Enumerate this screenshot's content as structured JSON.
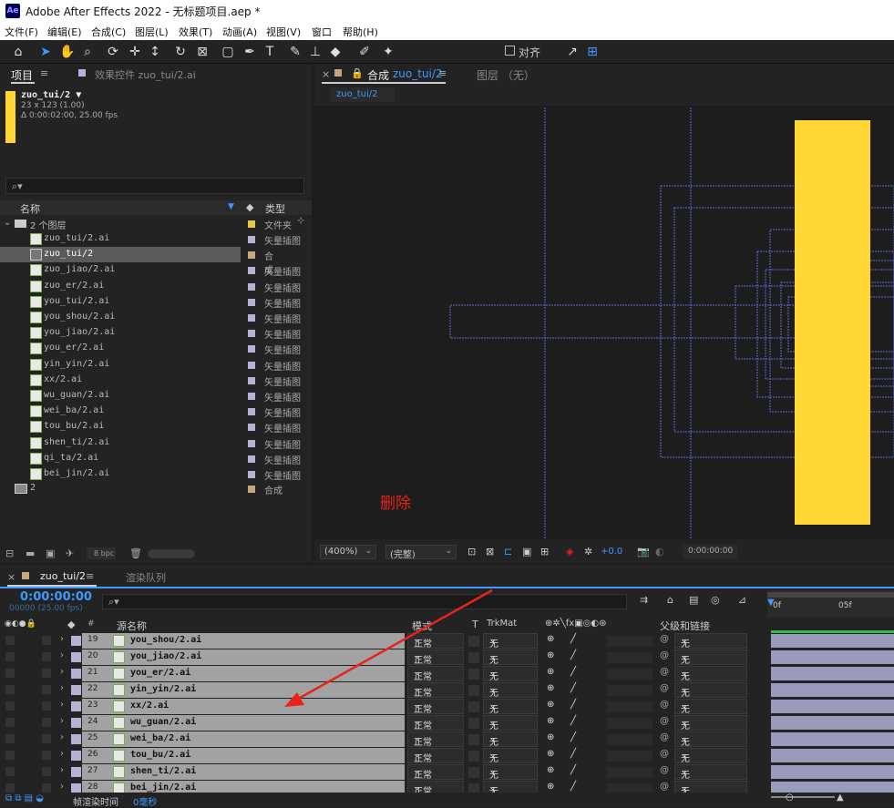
{
  "window": {
    "title": "Adobe After Effects 2022 - 无标题项目.aep *",
    "logo": "Ae"
  },
  "menu": [
    "文件(F)",
    "编辑(E)",
    "合成(C)",
    "图层(L)",
    "效果(T)",
    "动画(A)",
    "视图(V)",
    "窗口",
    "帮助(H)"
  ],
  "toolbar": {
    "snap_label": "对齐"
  },
  "project": {
    "tab": "项目",
    "effects_tab": "效果控件 zuo_tui/2.ai",
    "selected_name": "zuo_tui/2 ▼",
    "selected_dims": "23 x 123 (1.00)",
    "selected_dur": "Δ 0:00:02:00, 25.00 fps",
    "search_placeholder": "⌕▾",
    "col_name": "名称",
    "col_type": "类型",
    "folder": {
      "name": "2 个图层",
      "type": "文件夹"
    },
    "items": [
      {
        "name": "zuo_tui/2.ai",
        "type": "矢量插图"
      },
      {
        "name": "zuo_tui/2",
        "type": "合成"
      },
      {
        "name": "zuo_jiao/2.ai",
        "type": "矢量插图"
      },
      {
        "name": "zuo_er/2.ai",
        "type": "矢量插图"
      },
      {
        "name": "you_tui/2.ai",
        "type": "矢量插图"
      },
      {
        "name": "you_shou/2.ai",
        "type": "矢量插图"
      },
      {
        "name": "you_jiao/2.ai",
        "type": "矢量插图"
      },
      {
        "name": "you_er/2.ai",
        "type": "矢量插图"
      },
      {
        "name": "yin_yin/2.ai",
        "type": "矢量插图"
      },
      {
        "name": "xx/2.ai",
        "type": "矢量插图"
      },
      {
        "name": "wu_guan/2.ai",
        "type": "矢量插图"
      },
      {
        "name": "wei_ba/2.ai",
        "type": "矢量插图"
      },
      {
        "name": "tou_bu/2.ai",
        "type": "矢量插图"
      },
      {
        "name": "shen_ti/2.ai",
        "type": "矢量插图"
      },
      {
        "name": "qi_ta/2.ai",
        "type": "矢量插图"
      },
      {
        "name": "bei_jin/2.ai",
        "type": "矢量插图"
      }
    ],
    "root_comp": {
      "name": "2",
      "type": "合成"
    },
    "bpc": "8 bpc"
  },
  "comp": {
    "tab_prefix": "合成",
    "tab_name": "zuo_tui/2",
    "layer_tab": "图层 （无）",
    "crumb": "zuo_tui/2",
    "annotation": "删除",
    "zoom": "(400%)",
    "quality": "(完整)",
    "exposure": "+0.0",
    "timecode": "0:00:00:00"
  },
  "timeline": {
    "tab": "zuo_tui/2",
    "render_tab": "渲染队列",
    "timecode": "0:00:00:00",
    "frames": "00000 (25.00 fps)",
    "search_placeholder": "⌕▾",
    "col_source": "源名称",
    "col_mode": "模式",
    "col_t": "T",
    "col_trkmat": "TrkMat",
    "col_parent": "父级和链接",
    "ruler": [
      "0f",
      "05f"
    ],
    "layers": [
      {
        "num": "19",
        "name": "you_shou/2.ai",
        "mode": "正常",
        "trk": "无",
        "parent": "无"
      },
      {
        "num": "20",
        "name": "you_jiao/2.ai",
        "mode": "正常",
        "trk": "无",
        "parent": "无"
      },
      {
        "num": "21",
        "name": "you_er/2.ai",
        "mode": "正常",
        "trk": "无",
        "parent": "无"
      },
      {
        "num": "22",
        "name": "yin_yin/2.ai",
        "mode": "正常",
        "trk": "无",
        "parent": "无"
      },
      {
        "num": "23",
        "name": "xx/2.ai",
        "mode": "正常",
        "trk": "无",
        "parent": "无"
      },
      {
        "num": "24",
        "name": "wu_guan/2.ai",
        "mode": "正常",
        "trk": "无",
        "parent": "无"
      },
      {
        "num": "25",
        "name": "wei_ba/2.ai",
        "mode": "正常",
        "trk": "无",
        "parent": "无"
      },
      {
        "num": "26",
        "name": "tou_bu/2.ai",
        "mode": "正常",
        "trk": "无",
        "parent": "无"
      },
      {
        "num": "27",
        "name": "shen_ti/2.ai",
        "mode": "正常",
        "trk": "无",
        "parent": "无"
      },
      {
        "num": "28",
        "name": "bei_jin/2.ai",
        "mode": "正常",
        "trk": "无",
        "parent": "无"
      }
    ],
    "footer_label": "帧渲染时间",
    "footer_value": "0毫秒"
  },
  "colors": {
    "accent": "#3d9bff",
    "yellow": "#ffd633",
    "annotation": "#e8231a",
    "guide": "#5b6bd6"
  }
}
